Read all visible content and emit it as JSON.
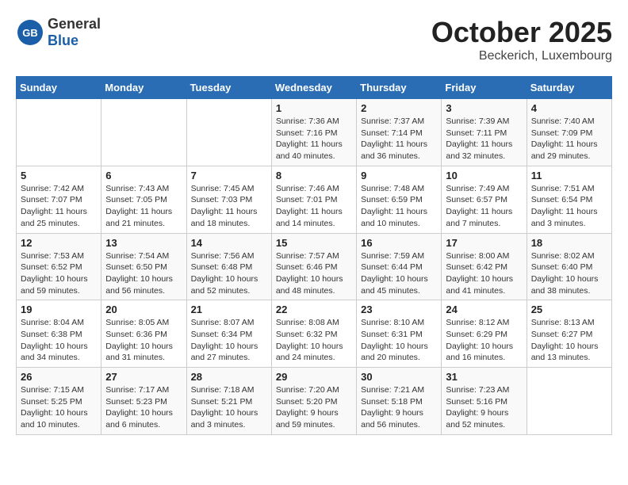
{
  "header": {
    "logo_general": "General",
    "logo_blue": "Blue",
    "month": "October 2025",
    "location": "Beckerich, Luxembourg"
  },
  "weekdays": [
    "Sunday",
    "Monday",
    "Tuesday",
    "Wednesday",
    "Thursday",
    "Friday",
    "Saturday"
  ],
  "weeks": [
    [
      {
        "day": "",
        "info": ""
      },
      {
        "day": "",
        "info": ""
      },
      {
        "day": "",
        "info": ""
      },
      {
        "day": "1",
        "info": "Sunrise: 7:36 AM\nSunset: 7:16 PM\nDaylight: 11 hours\nand 40 minutes."
      },
      {
        "day": "2",
        "info": "Sunrise: 7:37 AM\nSunset: 7:14 PM\nDaylight: 11 hours\nand 36 minutes."
      },
      {
        "day": "3",
        "info": "Sunrise: 7:39 AM\nSunset: 7:11 PM\nDaylight: 11 hours\nand 32 minutes."
      },
      {
        "day": "4",
        "info": "Sunrise: 7:40 AM\nSunset: 7:09 PM\nDaylight: 11 hours\nand 29 minutes."
      }
    ],
    [
      {
        "day": "5",
        "info": "Sunrise: 7:42 AM\nSunset: 7:07 PM\nDaylight: 11 hours\nand 25 minutes."
      },
      {
        "day": "6",
        "info": "Sunrise: 7:43 AM\nSunset: 7:05 PM\nDaylight: 11 hours\nand 21 minutes."
      },
      {
        "day": "7",
        "info": "Sunrise: 7:45 AM\nSunset: 7:03 PM\nDaylight: 11 hours\nand 18 minutes."
      },
      {
        "day": "8",
        "info": "Sunrise: 7:46 AM\nSunset: 7:01 PM\nDaylight: 11 hours\nand 14 minutes."
      },
      {
        "day": "9",
        "info": "Sunrise: 7:48 AM\nSunset: 6:59 PM\nDaylight: 11 hours\nand 10 minutes."
      },
      {
        "day": "10",
        "info": "Sunrise: 7:49 AM\nSunset: 6:57 PM\nDaylight: 11 hours\nand 7 minutes."
      },
      {
        "day": "11",
        "info": "Sunrise: 7:51 AM\nSunset: 6:54 PM\nDaylight: 11 hours\nand 3 minutes."
      }
    ],
    [
      {
        "day": "12",
        "info": "Sunrise: 7:53 AM\nSunset: 6:52 PM\nDaylight: 10 hours\nand 59 minutes."
      },
      {
        "day": "13",
        "info": "Sunrise: 7:54 AM\nSunset: 6:50 PM\nDaylight: 10 hours\nand 56 minutes."
      },
      {
        "day": "14",
        "info": "Sunrise: 7:56 AM\nSunset: 6:48 PM\nDaylight: 10 hours\nand 52 minutes."
      },
      {
        "day": "15",
        "info": "Sunrise: 7:57 AM\nSunset: 6:46 PM\nDaylight: 10 hours\nand 48 minutes."
      },
      {
        "day": "16",
        "info": "Sunrise: 7:59 AM\nSunset: 6:44 PM\nDaylight: 10 hours\nand 45 minutes."
      },
      {
        "day": "17",
        "info": "Sunrise: 8:00 AM\nSunset: 6:42 PM\nDaylight: 10 hours\nand 41 minutes."
      },
      {
        "day": "18",
        "info": "Sunrise: 8:02 AM\nSunset: 6:40 PM\nDaylight: 10 hours\nand 38 minutes."
      }
    ],
    [
      {
        "day": "19",
        "info": "Sunrise: 8:04 AM\nSunset: 6:38 PM\nDaylight: 10 hours\nand 34 minutes."
      },
      {
        "day": "20",
        "info": "Sunrise: 8:05 AM\nSunset: 6:36 PM\nDaylight: 10 hours\nand 31 minutes."
      },
      {
        "day": "21",
        "info": "Sunrise: 8:07 AM\nSunset: 6:34 PM\nDaylight: 10 hours\nand 27 minutes."
      },
      {
        "day": "22",
        "info": "Sunrise: 8:08 AM\nSunset: 6:32 PM\nDaylight: 10 hours\nand 24 minutes."
      },
      {
        "day": "23",
        "info": "Sunrise: 8:10 AM\nSunset: 6:31 PM\nDaylight: 10 hours\nand 20 minutes."
      },
      {
        "day": "24",
        "info": "Sunrise: 8:12 AM\nSunset: 6:29 PM\nDaylight: 10 hours\nand 16 minutes."
      },
      {
        "day": "25",
        "info": "Sunrise: 8:13 AM\nSunset: 6:27 PM\nDaylight: 10 hours\nand 13 minutes."
      }
    ],
    [
      {
        "day": "26",
        "info": "Sunrise: 7:15 AM\nSunset: 5:25 PM\nDaylight: 10 hours\nand 10 minutes."
      },
      {
        "day": "27",
        "info": "Sunrise: 7:17 AM\nSunset: 5:23 PM\nDaylight: 10 hours\nand 6 minutes."
      },
      {
        "day": "28",
        "info": "Sunrise: 7:18 AM\nSunset: 5:21 PM\nDaylight: 10 hours\nand 3 minutes."
      },
      {
        "day": "29",
        "info": "Sunrise: 7:20 AM\nSunset: 5:20 PM\nDaylight: 9 hours\nand 59 minutes."
      },
      {
        "day": "30",
        "info": "Sunrise: 7:21 AM\nSunset: 5:18 PM\nDaylight: 9 hours\nand 56 minutes."
      },
      {
        "day": "31",
        "info": "Sunrise: 7:23 AM\nSunset: 5:16 PM\nDaylight: 9 hours\nand 52 minutes."
      },
      {
        "day": "",
        "info": ""
      }
    ]
  ]
}
